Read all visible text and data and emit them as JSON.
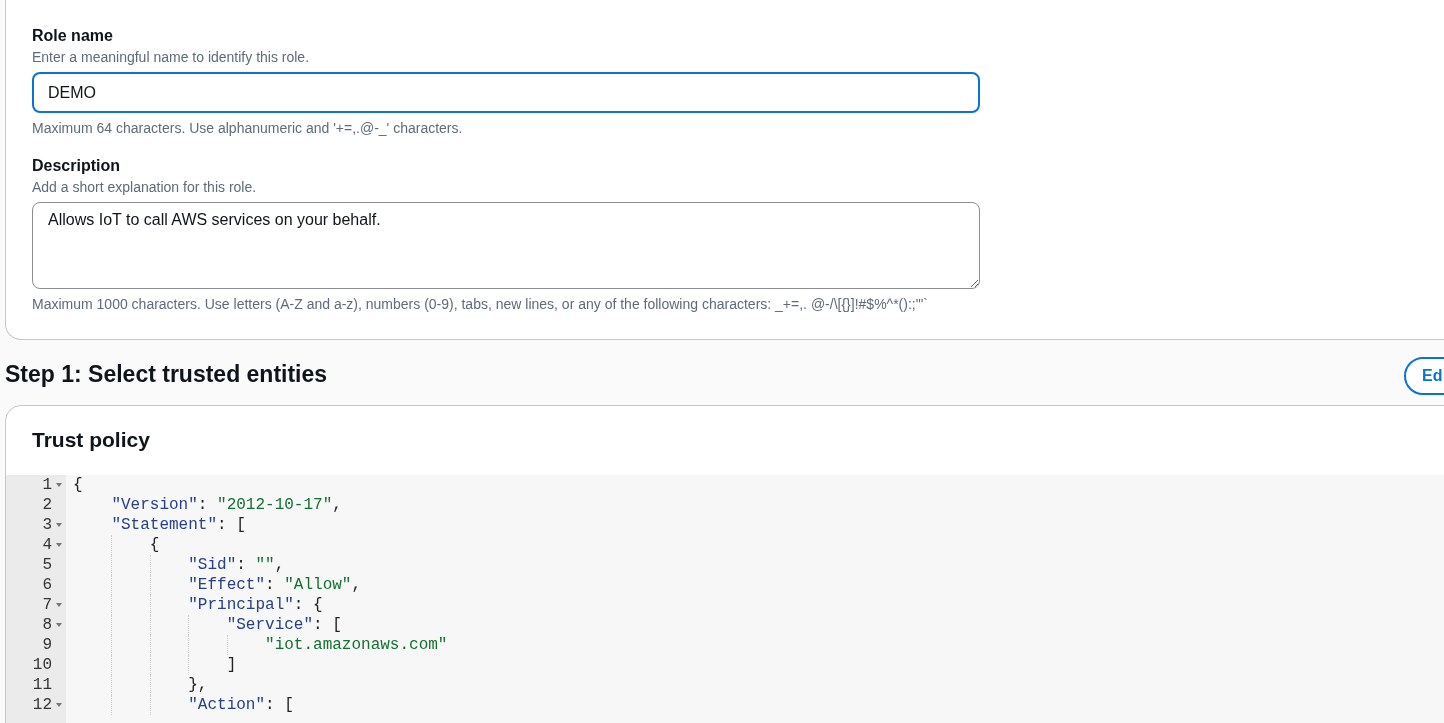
{
  "role_name": {
    "label": "Role name",
    "hint": "Enter a meaningful name to identify this role.",
    "value": "DEMO",
    "focused": true,
    "constraint": "Maximum 64 characters. Use alphanumeric and '+=,.@-_' characters."
  },
  "description": {
    "label": "Description",
    "hint": "Add a short explanation for this role.",
    "value": "Allows IoT to call AWS services on your behalf.",
    "focused": false,
    "constraint": "Maximum 1000 characters. Use letters (A-Z and a-z), numbers (0-9), tabs, new lines, or any of the following characters: _+=,. @-/\\[{}]!#$%^*():;\"'`"
  },
  "step": {
    "title": "Step 1: Select trusted entities",
    "edit_button": "Ed"
  },
  "trust_policy": {
    "title": "Trust policy",
    "lines": [
      {
        "number": "1",
        "foldable": true,
        "tokens": [
          {
            "kind": "punct",
            "text": "{"
          }
        ]
      },
      {
        "number": "2",
        "foldable": false,
        "tokens": [
          {
            "kind": "key",
            "text": "    \"Version\""
          },
          {
            "kind": "punct",
            "text": ": "
          },
          {
            "kind": "string",
            "text": "\"2012-10-17\""
          },
          {
            "kind": "punct",
            "text": ","
          }
        ]
      },
      {
        "number": "3",
        "foldable": true,
        "tokens": [
          {
            "kind": "key",
            "text": "    \"Statement\""
          },
          {
            "kind": "punct",
            "text": ": ["
          }
        ]
      },
      {
        "number": "4",
        "foldable": true,
        "tokens": [
          {
            "kind": "punct",
            "text": "        {"
          }
        ]
      },
      {
        "number": "5",
        "foldable": false,
        "tokens": [
          {
            "kind": "key",
            "text": "            \"Sid\""
          },
          {
            "kind": "punct",
            "text": ": "
          },
          {
            "kind": "string",
            "text": "\"\""
          },
          {
            "kind": "punct",
            "text": ","
          }
        ]
      },
      {
        "number": "6",
        "foldable": false,
        "tokens": [
          {
            "kind": "key",
            "text": "            \"Effect\""
          },
          {
            "kind": "punct",
            "text": ": "
          },
          {
            "kind": "string",
            "text": "\"Allow\""
          },
          {
            "kind": "punct",
            "text": ","
          }
        ]
      },
      {
        "number": "7",
        "foldable": true,
        "tokens": [
          {
            "kind": "key",
            "text": "            \"Principal\""
          },
          {
            "kind": "punct",
            "text": ": {"
          }
        ]
      },
      {
        "number": "8",
        "foldable": true,
        "tokens": [
          {
            "kind": "key",
            "text": "                \"Service\""
          },
          {
            "kind": "punct",
            "text": ": ["
          }
        ]
      },
      {
        "number": "9",
        "foldable": false,
        "tokens": [
          {
            "kind": "string",
            "text": "                    \"iot.amazonaws.com\""
          }
        ]
      },
      {
        "number": "10",
        "foldable": false,
        "tokens": [
          {
            "kind": "punct",
            "text": "                ]"
          }
        ]
      },
      {
        "number": "11",
        "foldable": false,
        "tokens": [
          {
            "kind": "punct",
            "text": "            },"
          }
        ]
      },
      {
        "number": "12",
        "foldable": true,
        "tokens": [
          {
            "kind": "key",
            "text": "            \"Action\""
          },
          {
            "kind": "punct",
            "text": ": ["
          }
        ]
      }
    ]
  }
}
